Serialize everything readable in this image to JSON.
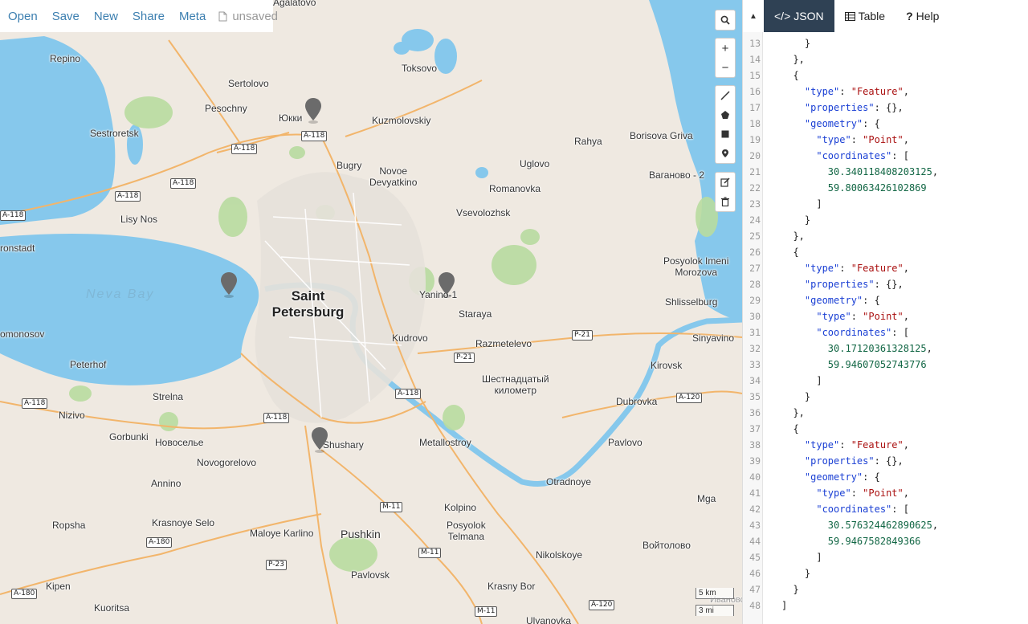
{
  "toolbar": {
    "items": [
      "Open",
      "Save",
      "New",
      "Share",
      "Meta"
    ],
    "file_icon": "file-icon",
    "status": "unsaved"
  },
  "map": {
    "places": {
      "saint_petersburg": "Saint Petersburg",
      "neva_bay": "Neva Bay",
      "agalatovo": "Agalatovo",
      "repino": "Repino",
      "sertolovo": "Sertolovo",
      "pesochny": "Pesochny",
      "yukki": "Юкки",
      "toksovo": "Toksovo",
      "kuzmolovskiy": "Kuzmolovskiy",
      "sestroretsk": "Sestroretsk",
      "bugry": "Bugry",
      "novoe_devyatkino": "Novoe\nDevyatkino",
      "uglovo": "Uglovo",
      "rahya": "Rahya",
      "borisova_griva": "Borisova Griva",
      "vaganovo": "Ваганово - 2",
      "romanovka": "Romanovka",
      "lisy_nos": "Lisy Nos",
      "vsevolozhsk": "Vsevolozhsk",
      "kronstadt": "ronstadt",
      "posyolok_imeni_morozova": "Posyolok Imeni\nMorozova",
      "yanino": "Yanino-1",
      "shlisselburg": "Shlisselburg",
      "staraya": "Staraya",
      "lomonosov": "omonosov",
      "razmetelevo": "Razmetelevo",
      "sinyavino": "Sinyavino",
      "kudrovo": "Kudrovo",
      "peterhof": "Peterhof",
      "kirovsk": "Kirovsk",
      "shestnadtsaty": "Шестнадцатый\nкилометр",
      "strelna": "Strelna",
      "dubrovka": "Dubrovka",
      "nizivo": "Nizivo",
      "gorbunki": "Gorbunki",
      "novoselye": "Новоселье",
      "shushary": "Shushary",
      "metallostroy": "Metallostroy",
      "pavlovo": "Pavlovo",
      "novogorelovo": "Novogorelovo",
      "annino": "Annino",
      "otradnoye": "Otradnoye",
      "mga": "Mga",
      "ropsha": "Ropsha",
      "krasnoye_selo": "Krasnoye Selo",
      "kolpino": "Kolpino",
      "maloye_karlino": "Maloye Karlino",
      "pushkin": "Pushkin",
      "posyolok_telmana": "Posyolok\nTelmana",
      "voytolovo": "Войтолово",
      "nikolskoye": "Nikolskoye",
      "pavlovsk": "Pavlovsk",
      "kipen": "Kipen",
      "kuoritsa": "Kuoritsa",
      "krasny_bor": "Krasny Bor",
      "ulyanovka": "Ulyanovka",
      "ivanovo": "Иваново"
    },
    "shields": {
      "a118": "A-118",
      "a120": "A-120",
      "a180": "A-180",
      "p21": "P-21",
      "p23": "P-23",
      "m11": "M-11"
    },
    "controls": {
      "search": "search-icon",
      "zoom_in": "+",
      "zoom_out": "−",
      "draw_line": "line-icon",
      "draw_polygon": "polygon-icon",
      "draw_rectangle": "rectangle-icon",
      "draw_marker": "marker-icon",
      "edit": "edit-icon",
      "delete": "trash-icon"
    },
    "scale": {
      "km": "5 km",
      "mi": "3 mi"
    },
    "colors": {
      "water": "#86c8ec",
      "land": "#efe9e1",
      "pin": "#6b6b6b"
    }
  },
  "panel": {
    "tabs": [
      {
        "label": "JSON",
        "icon": "code-icon",
        "active": true
      },
      {
        "label": "Table",
        "icon": "table-icon",
        "active": false
      },
      {
        "label": "Help",
        "icon": "question-icon",
        "active": false
      }
    ],
    "collapse_icon": "caret-up-icon",
    "first_line_number": 13,
    "code_lines": [
      "    }",
      "  },",
      "  {",
      "    \"type\": \"Feature\",",
      "    \"properties\": {},",
      "    \"geometry\": {",
      "      \"type\": \"Point\",",
      "      \"coordinates\": [",
      "        30.340118408203125,",
      "        59.80063426102869",
      "      ]",
      "    }",
      "  },",
      "  {",
      "    \"type\": \"Feature\",",
      "    \"properties\": {},",
      "    \"geometry\": {",
      "      \"type\": \"Point\",",
      "      \"coordinates\": [",
      "        30.17120361328125,",
      "        59.94607052743776",
      "      ]",
      "    }",
      "  },",
      "  {",
      "    \"type\": \"Feature\",",
      "    \"properties\": {},",
      "    \"geometry\": {",
      "      \"type\": \"Point\",",
      "      \"coordinates\": [",
      "        30.576324462890625,",
      "        59.9467582849366",
      "      ]",
      "    }",
      "  }",
      "]"
    ]
  }
}
